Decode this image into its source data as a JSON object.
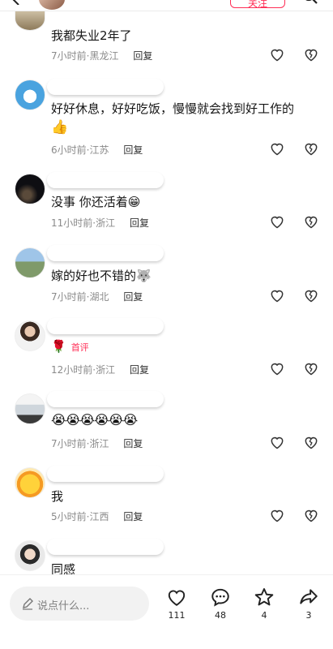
{
  "topbar": {
    "follow_label": "关注"
  },
  "comments": [
    {
      "text": "我都失业2年了",
      "time": "7小时前",
      "location": "黑龙江",
      "reply": "回复"
    },
    {
      "text": "好好休息，好好吃饭，慢慢就会找到好工作的",
      "emoji": "👍",
      "time": "6小时前",
      "location": "江苏",
      "reply": "回复"
    },
    {
      "text": "没事 你还活着",
      "emoji": "😁",
      "time": "11小时前",
      "location": "浙江",
      "reply": "回复"
    },
    {
      "text": "嫁的好也不错的",
      "emoji": "🐺",
      "time": "7小时前",
      "location": "湖北",
      "reply": "回复"
    },
    {
      "emoji": "🌹",
      "badge": "首评",
      "time": "12小时前",
      "location": "浙江",
      "reply": "回复"
    },
    {
      "emoji": "😭😭😭😭😭😭",
      "time": "7小时前",
      "location": "浙江",
      "reply": "回复"
    },
    {
      "text": "我",
      "time": "5小时前",
      "location": "江西",
      "reply": "回复"
    },
    {
      "text": "同感"
    }
  ],
  "bottombar": {
    "input_placeholder": "说点什么...",
    "like_count": "111",
    "comment_count": "48",
    "star_count": "4",
    "share_count": "3"
  },
  "icons": {
    "like": "heart-outline-icon",
    "dislike": "broken-heart-icon",
    "comment": "comment-bubble-icon",
    "star": "star-outline-icon",
    "share": "share-arrow-icon",
    "pencil": "pencil-icon"
  },
  "colors": {
    "accent": "#ff2d55",
    "muted": "#8a8a8a"
  }
}
